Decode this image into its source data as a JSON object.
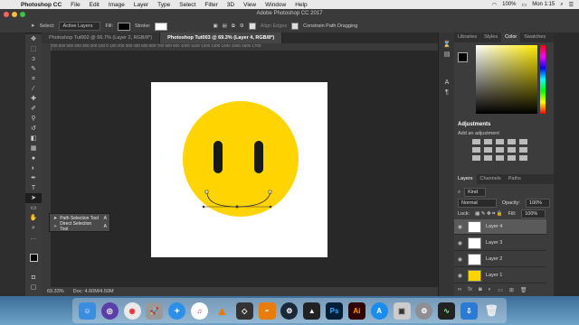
{
  "menubar": {
    "app": "Photoshop CC",
    "items": [
      "File",
      "Edit",
      "Image",
      "Layer",
      "Type",
      "Select",
      "Filter",
      "3D",
      "View",
      "Window",
      "Help"
    ],
    "battery": "100%",
    "clock": "Mon 1:15"
  },
  "window": {
    "title": "Adobe Photoshop CC 2017"
  },
  "options": {
    "select_label": "Select:",
    "select_value": "Active Layers",
    "fill_label": "Fill:",
    "stroke_label": "Stroke:",
    "align_edges": "Align Edges",
    "constrain": "Constrain Path Dragging"
  },
  "tabs": [
    {
      "label": "Photoshop Tut002 @ 66.7% (Layer 2, RGB/8*)"
    },
    {
      "label": "Photoshop Tut003 @ 69.3% (Layer 4, RGB/8*)"
    }
  ],
  "ruler_marks": "700  600  500  400  300  200  100   0   100  200  300  400  500  600  700  800  900  1000 1100 1200 1300 1400 1500 1600 1700",
  "status": {
    "zoom": "69.33%",
    "doc": "Doc: 4.60M/4.50M"
  },
  "flyout": {
    "items": [
      {
        "label": "Path Selection Tool",
        "key": "A"
      },
      {
        "label": "Direct Selection Tool",
        "key": "A"
      }
    ]
  },
  "panels": {
    "color_tabs": [
      "Libraries",
      "Styles",
      "Color",
      "Swatches"
    ],
    "adjustments_title": "Adjustments",
    "adjustments_sub": "Add an adjustment",
    "layer_tabs": [
      "Layers",
      "Channels",
      "Paths"
    ],
    "kind": "Kind",
    "blend": "Normal",
    "opacity_label": "Opacity:",
    "opacity_value": "100%",
    "lock_label": "Lock:",
    "fill_label": "Fill:",
    "fill_value": "100%",
    "layers": [
      {
        "name": "Layer 4",
        "selected": true
      },
      {
        "name": "Layer 3",
        "selected": false
      },
      {
        "name": "Layer 2",
        "selected": false
      },
      {
        "name": "Layer 1",
        "selected": false
      }
    ]
  },
  "colors": {
    "face": "#FFD400",
    "eyes": "#1a1a1a",
    "accent": "#ffea00"
  },
  "dock_icons": [
    "finder-icon",
    "siri-icon",
    "chrome-icon",
    "launchpad-icon",
    "safari-icon",
    "itunes-icon",
    "vlc-icon",
    "unity-icon",
    "blender-icon",
    "steam-icon",
    "game-icon",
    "photoshop-icon",
    "illustrator-icon",
    "appstore-icon",
    "preview-icon",
    "sysprefs-icon",
    "activity-icon",
    "downloads-icon",
    "trash-icon"
  ],
  "dock_labels": {
    "ps": "Ps",
    "ai": "Ai"
  }
}
